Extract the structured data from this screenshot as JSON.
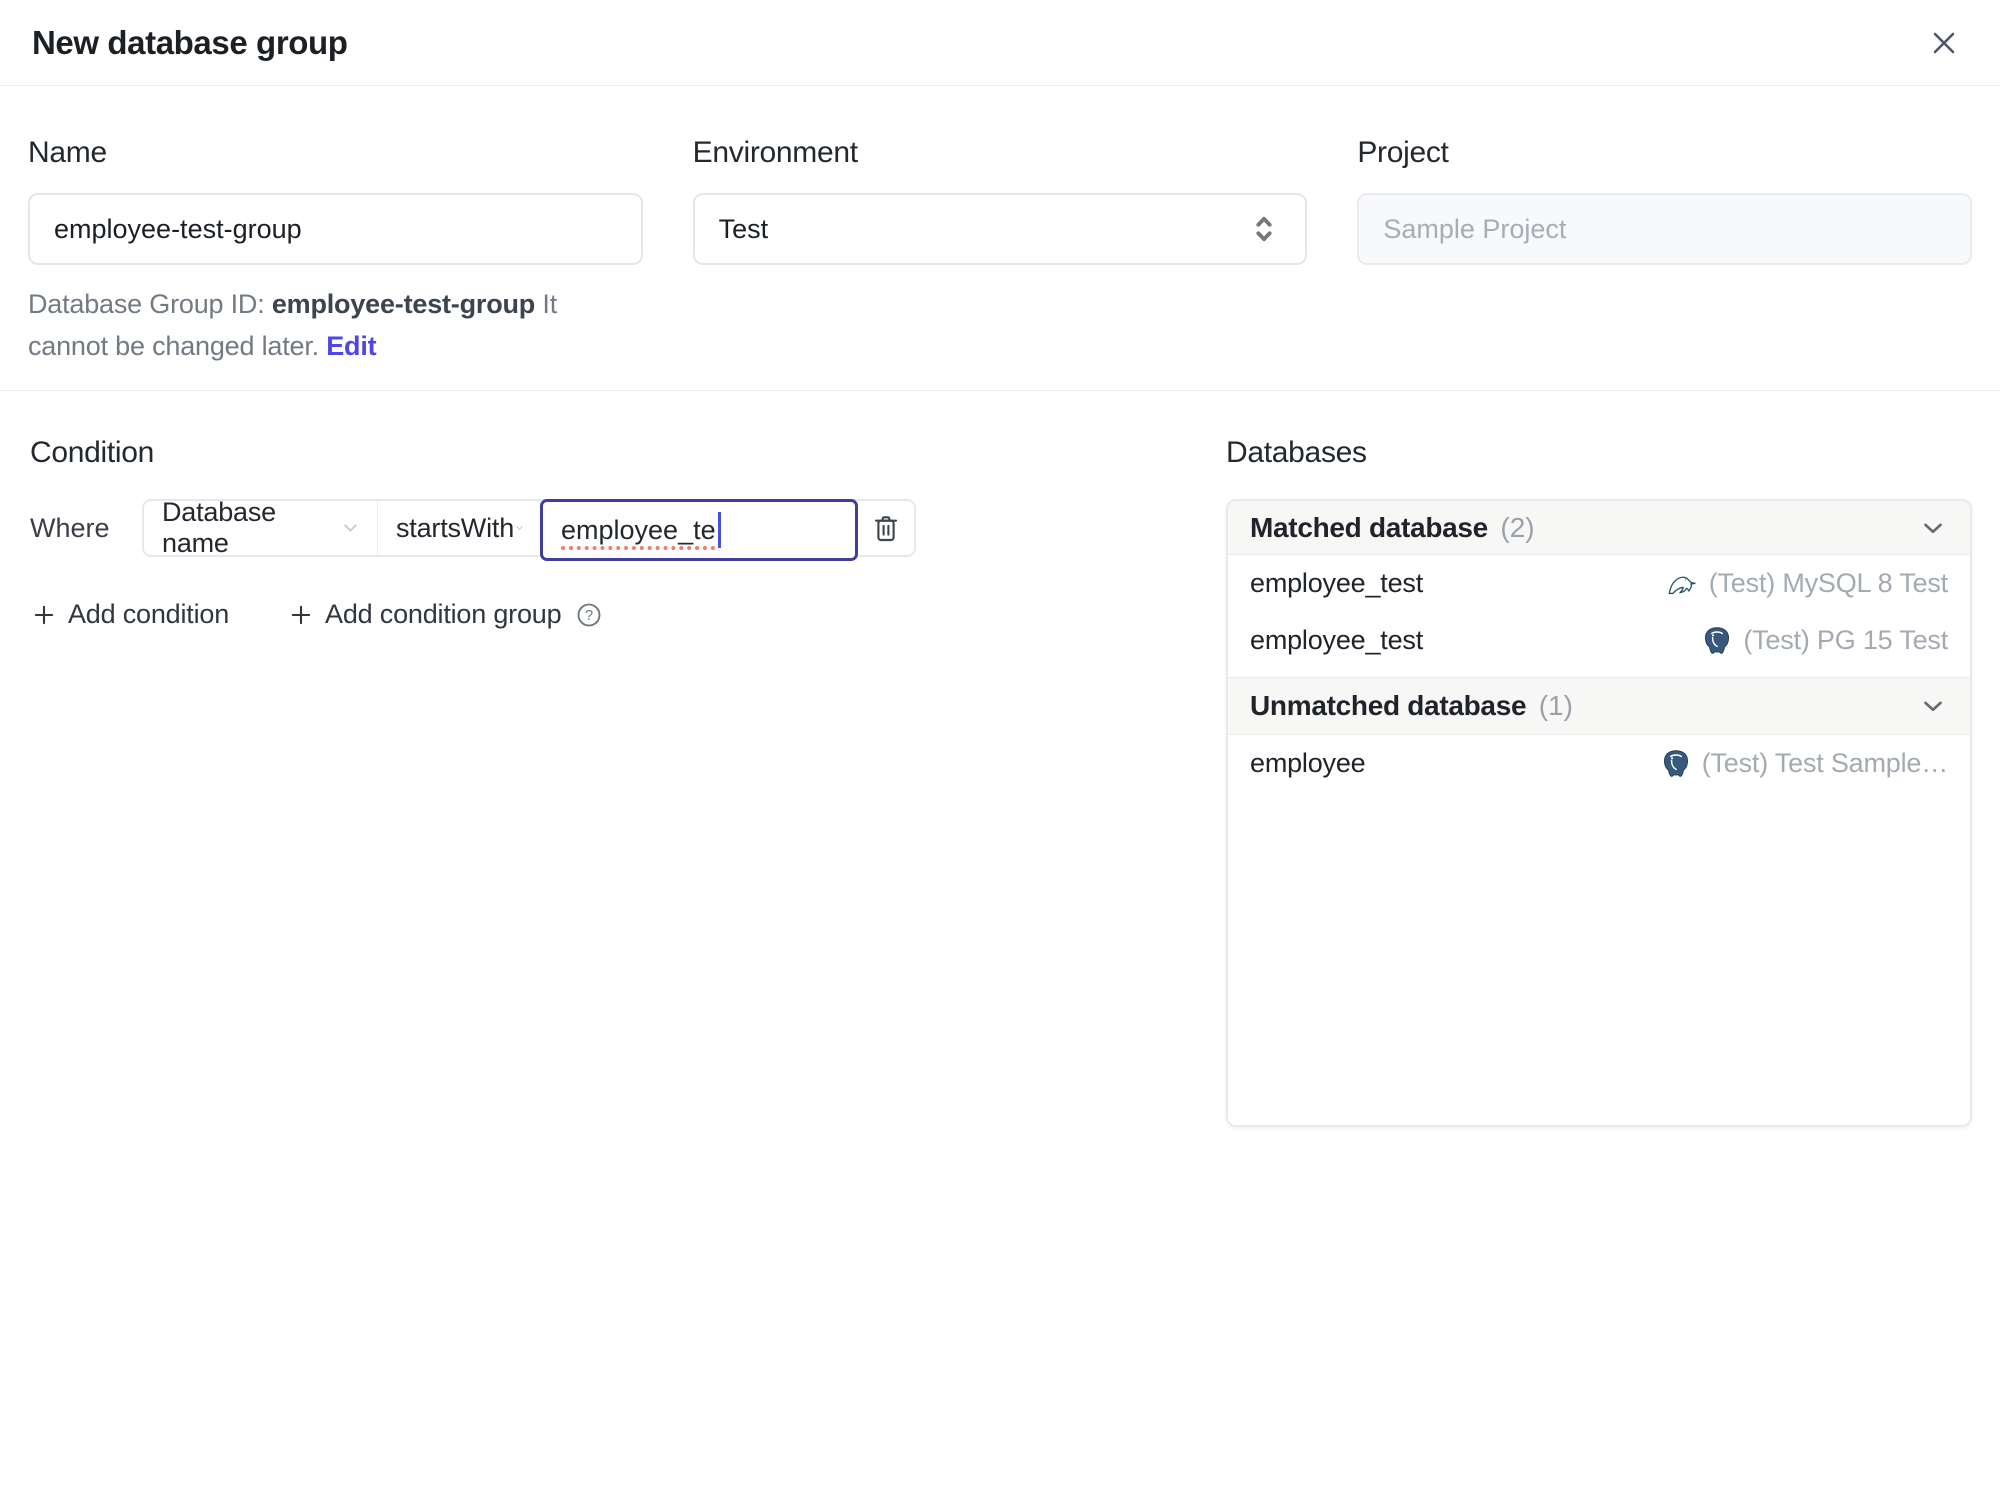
{
  "dialog": {
    "title": "New database group"
  },
  "form": {
    "name_label": "Name",
    "name_value": "employee-test-group",
    "environment_label": "Environment",
    "environment_value": "Test",
    "project_label": "Project",
    "project_value": "Sample Project",
    "group_id_prefix": "Database Group ID:",
    "group_id_value": "employee-test-group",
    "group_id_suffix": "It cannot be changed later.",
    "edit_link": "Edit"
  },
  "condition": {
    "heading": "Condition",
    "where_label": "Where",
    "factor_value": "Database name",
    "operator_value": "startsWith",
    "value_input": "employee_te",
    "add_condition": "Add condition",
    "add_condition_group": "Add condition group"
  },
  "databases": {
    "heading": "Databases",
    "matched": {
      "title": "Matched database",
      "count": "(2)",
      "rows": [
        {
          "name": "employee_test",
          "engine": "mysql",
          "instance": "(Test) MySQL 8 Test"
        },
        {
          "name": "employee_test",
          "engine": "postgresql",
          "instance": "(Test) PG 15 Test"
        }
      ]
    },
    "unmatched": {
      "title": "Unmatched database",
      "count": "(1)",
      "rows": [
        {
          "name": "employee",
          "engine": "postgresql",
          "instance": "(Test) Test Sample…"
        }
      ]
    }
  },
  "colors": {
    "accent": "#4f46e5",
    "focus_border": "#413e9e",
    "spellcheck_underline": "#ef7b72",
    "panel_header_bg": "#f7f7f6",
    "mysql_icon": "#24566e",
    "postgresql_icon": "#38597b"
  }
}
